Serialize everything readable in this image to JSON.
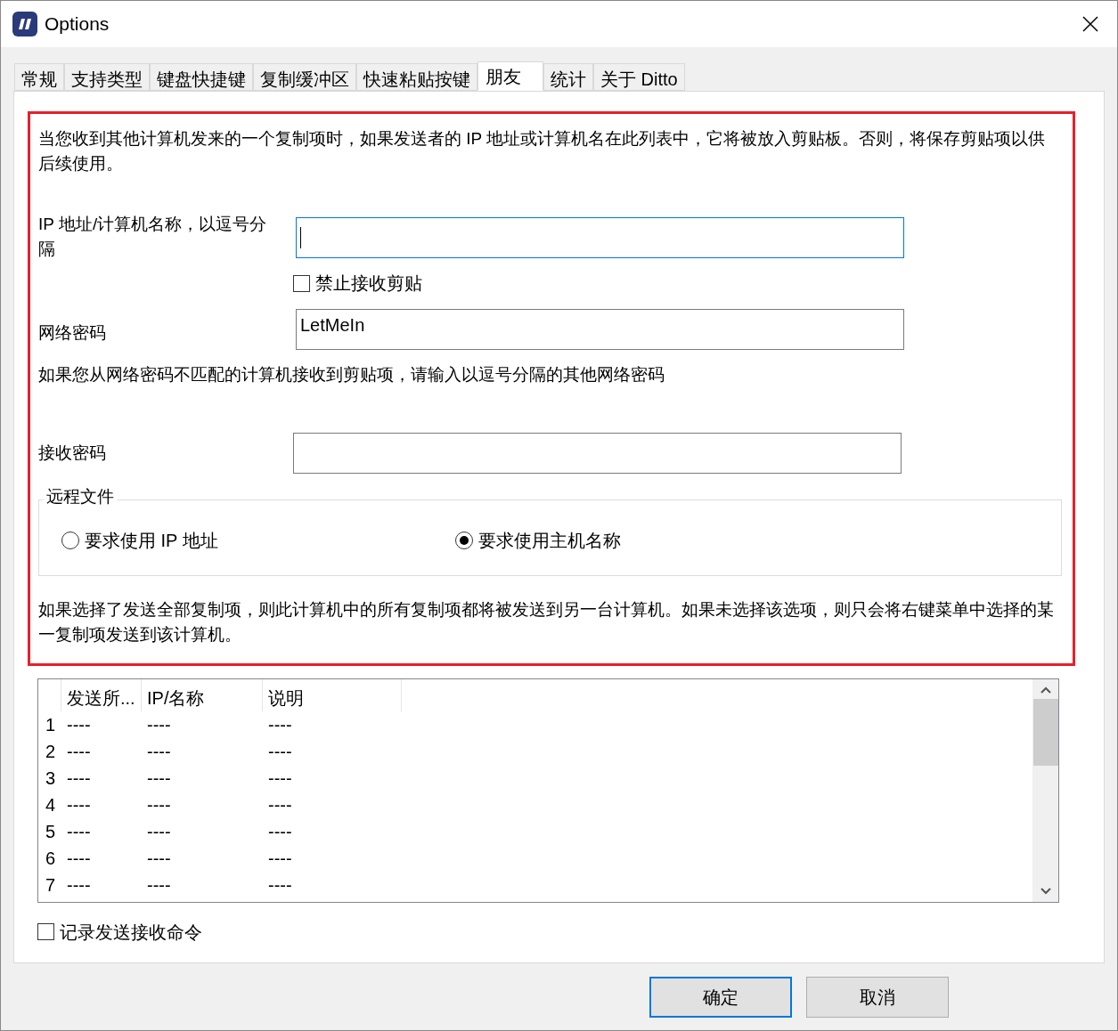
{
  "window": {
    "title": "Options"
  },
  "tabs": [
    {
      "label": "常规",
      "selected": false
    },
    {
      "label": "支持类型",
      "selected": false
    },
    {
      "label": "键盘快捷键",
      "selected": false
    },
    {
      "label": "复制缓冲区",
      "selected": false
    },
    {
      "label": "快速粘贴按键",
      "selected": false
    },
    {
      "label": "朋友",
      "selected": true
    },
    {
      "label": "统计",
      "selected": false
    },
    {
      "label": "关于 Ditto",
      "selected": false
    }
  ],
  "intro": "当您收到其他计算机发来的一个复制项时，如果发送者的 IP 地址或计算机名在此列表中，它将被放入剪贴板。否则，将保存剪贴项以供后续使用。",
  "ip_field": {
    "label": "IP 地址/计算机名称，以逗号分隔",
    "focused": true
  },
  "disable_receive": {
    "label": "禁止接收剪贴",
    "checked": false
  },
  "network_password": {
    "label": "网络密码",
    "value": "LetMeIn",
    "focused": false
  },
  "extra_note": "如果您从网络密码不匹配的计算机接收到剪贴项，请输入以逗号分隔的其他网络密码",
  "receive_password": {
    "label": "接收密码",
    "focused": false
  },
  "remote_files": {
    "title": "远程文件",
    "options": [
      {
        "label": "要求使用 IP 地址",
        "selected": false
      },
      {
        "label": "要求使用主机名称",
        "selected": true
      }
    ]
  },
  "send_all_note": "如果选择了发送全部复制项，则此计算机中的所有复制项都将被发送到另一台计算机。如果未选择该选项，则只会将右键菜单中选择的某一复制项发送到该计算机。",
  "table": {
    "columns": [
      "发送所...",
      "IP/名称",
      "说明"
    ],
    "rows": [
      {
        "number": "1",
        "cells": [
          "----",
          "----",
          "----"
        ]
      },
      {
        "number": "2",
        "cells": [
          "----",
          "----",
          "----"
        ]
      },
      {
        "number": "3",
        "cells": [
          "----",
          "----",
          "----"
        ]
      },
      {
        "number": "4",
        "cells": [
          "----",
          "----",
          "----"
        ]
      },
      {
        "number": "5",
        "cells": [
          "----",
          "----",
          "----"
        ]
      },
      {
        "number": "6",
        "cells": [
          "----",
          "----",
          "----"
        ]
      },
      {
        "number": "7",
        "cells": [
          "----",
          "----",
          "----"
        ]
      }
    ]
  },
  "log_commands": {
    "label": "记录发送接收命令",
    "checked": false
  },
  "buttons": [
    {
      "label": "确定",
      "default": true
    },
    {
      "label": "取消",
      "default": false
    }
  ]
}
